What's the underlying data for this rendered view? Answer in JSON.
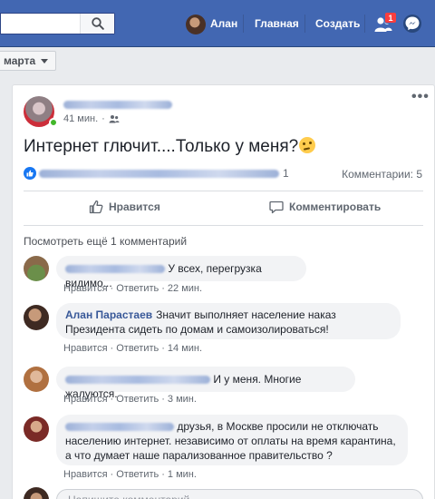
{
  "topbar": {
    "user_name": "Алан",
    "home_label": "Главная",
    "create_label": "Создать",
    "notification_count": "1",
    "bg_color": "#4267b2"
  },
  "filter": {
    "selected": "марта"
  },
  "post": {
    "time": "41 мин.",
    "text": "Интернет глючит....Только у меня?",
    "emoji": "thinking-face",
    "reaction_count": "1",
    "comments_label": "Комментарии: 5",
    "like_label": "Нравится",
    "comment_label": "Комментировать",
    "more_comments": "Посмотреть ещё 1 комментарий"
  },
  "comments": [
    {
      "author": "",
      "text": "У всех, перегрузка видимо...",
      "like": "Нравится",
      "reply": "Ответить",
      "time": "22 мин."
    },
    {
      "author": "Алан Парастаев",
      "text": "Значит выполняет население наказ Президента сидеть по домам и самоизолироваться!",
      "like": "Нравится",
      "reply": "Ответить",
      "time": "14 мин."
    },
    {
      "author": "",
      "text": "И у меня. Многие жалуются.",
      "like": "Нравится",
      "reply": "Ответить",
      "time": "3 мин."
    },
    {
      "author": "",
      "text": "друзья, в Москве просили не отключать населению интернет. независимо от оплаты на время карантина, а что думает наше парализованное правительство ?",
      "like": "Нравится",
      "reply": "Ответить",
      "time": "1 мин."
    }
  ],
  "compose": {
    "placeholder": "Напишите комментарий..."
  }
}
